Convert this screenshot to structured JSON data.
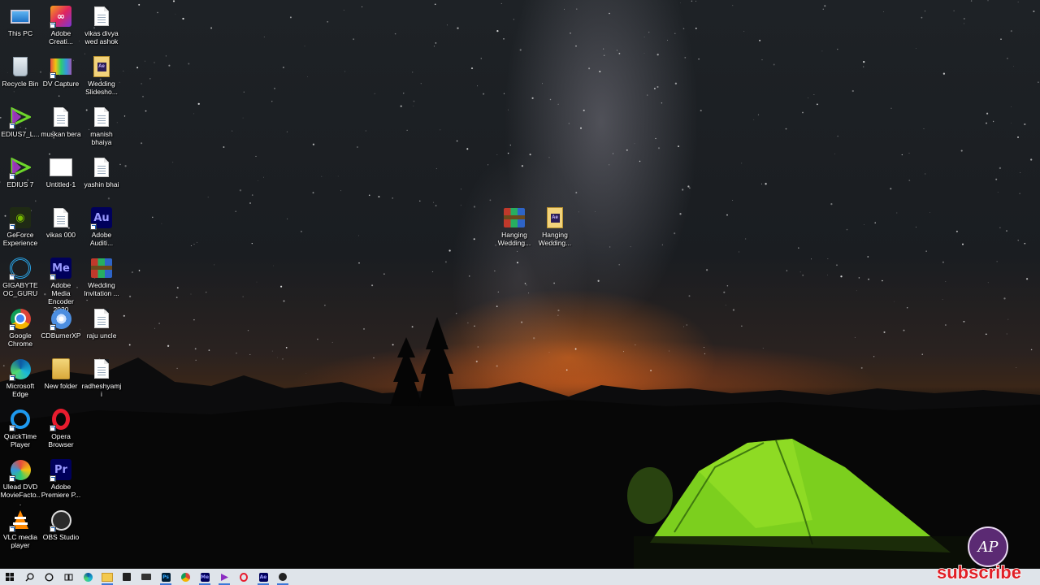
{
  "desktop": {
    "icons": [
      {
        "name": "This PC",
        "icon": "this-pc-icon"
      },
      {
        "name": "Adobe Creati...",
        "icon": "adobe-creative-cloud-icon"
      },
      {
        "name": "vikas divya wed ashok",
        "icon": "document-icon"
      },
      {
        "name": "Recycle Bin",
        "icon": "recycle-bin-icon"
      },
      {
        "name": "DV Capture",
        "icon": "dv-capture-icon"
      },
      {
        "name": "Wedding Slidesho...",
        "icon": "after-effects-file-icon"
      },
      {
        "name": "EDIUS7_L...",
        "icon": "edius-icon"
      },
      {
        "name": "muskan bera",
        "icon": "document-icon"
      },
      {
        "name": "manish bhaiya",
        "icon": "document-icon"
      },
      {
        "name": "EDIUS 7",
        "icon": "edius-icon"
      },
      {
        "name": "Untitled-1",
        "icon": "blank-image-icon"
      },
      {
        "name": "yashin bhai",
        "icon": "document-icon"
      },
      {
        "name": "GeForce Experience",
        "icon": "geforce-icon"
      },
      {
        "name": "vikas 000",
        "icon": "document-icon"
      },
      {
        "name": "Adobe Auditi...",
        "icon": "adobe-audition-icon"
      },
      {
        "name": "GIGABYTE OC_GURU",
        "icon": "gigabyte-icon"
      },
      {
        "name": "Adobe Media Encoder 2020",
        "icon": "adobe-media-encoder-icon"
      },
      {
        "name": "Wedding Invitation ...",
        "icon": "winrar-archive-icon"
      },
      {
        "name": "Google Chrome",
        "icon": "chrome-icon"
      },
      {
        "name": "CDBurnerXP",
        "icon": "cdburnerxp-icon"
      },
      {
        "name": "raju uncle",
        "icon": "document-icon"
      },
      {
        "name": "Microsoft Edge",
        "icon": "edge-icon"
      },
      {
        "name": "New folder",
        "icon": "folder-icon"
      },
      {
        "name": "radheshyamji",
        "icon": "document-icon"
      },
      {
        "name": "QuickTime Player",
        "icon": "quicktime-icon"
      },
      {
        "name": "Opera Browser",
        "icon": "opera-icon"
      },
      {
        "name": "Ulead DVD MovieFacto...",
        "icon": "ulead-dvd-icon"
      },
      {
        "name": "Adobe Premiere P...",
        "icon": "adobe-premiere-icon"
      },
      {
        "name": "VLC media player",
        "icon": "vlc-icon"
      },
      {
        "name": "OBS Studio",
        "icon": "obs-icon"
      },
      {
        "name": "Hanging Wedding...",
        "icon": "winrar-archive-icon"
      },
      {
        "name": "Hanging Wedding...",
        "icon": "after-effects-file-icon"
      }
    ]
  },
  "watermark": {
    "logo_text": "AP",
    "subscribe_text": "subscribe",
    "subscribe_color": "#e01f26"
  },
  "taskbar": {
    "items": [
      {
        "icon": "windows-start-icon"
      },
      {
        "icon": "search-icon"
      },
      {
        "icon": "cortana-icon"
      },
      {
        "icon": "task-view-icon"
      },
      {
        "icon": "edge-icon"
      },
      {
        "icon": "file-explorer-icon"
      },
      {
        "icon": "store-icon"
      },
      {
        "icon": "mail-icon"
      },
      {
        "icon": "photoshop-icon",
        "label": "Ps"
      },
      {
        "icon": "chrome-icon"
      },
      {
        "icon": "adobe-media-encoder-icon",
        "label": "Me"
      },
      {
        "icon": "edius-icon"
      },
      {
        "icon": "opera-icon"
      },
      {
        "icon": "after-effects-icon",
        "label": "Ae"
      },
      {
        "icon": "obs-icon"
      }
    ]
  }
}
